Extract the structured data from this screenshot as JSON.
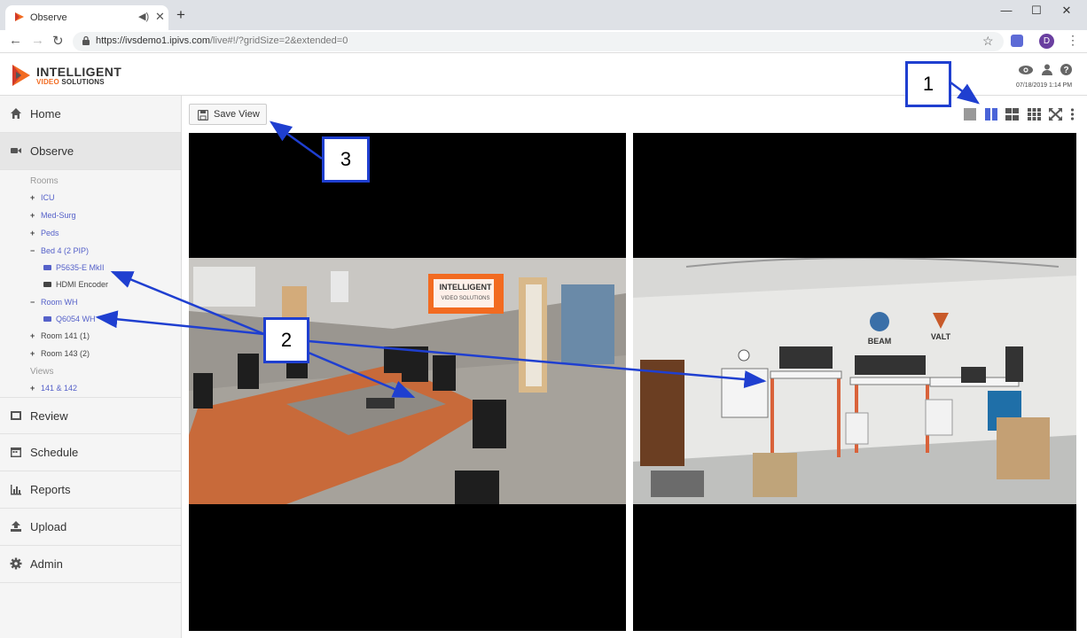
{
  "browser": {
    "tab_title": "Observe",
    "url_host": "https://ivsdemo1.ipivs.com",
    "url_path": "/live#!/?gridSize=2&extended=0",
    "profile_initial": "D"
  },
  "header": {
    "logo_line1": "INTELLIGENT",
    "logo_line2a": "VIDEO",
    "logo_line2b": "SOLUTIONS",
    "datetime": "07/18/2019 1:14 PM"
  },
  "sidebar": {
    "nav": [
      {
        "label": "Home",
        "icon": "home-icon"
      },
      {
        "label": "Observe",
        "icon": "video-camera-icon"
      },
      {
        "label": "Review",
        "icon": "film-icon"
      },
      {
        "label": "Schedule",
        "icon": "calendar-icon"
      },
      {
        "label": "Reports",
        "icon": "bar-chart-icon"
      },
      {
        "label": "Upload",
        "icon": "upload-icon"
      },
      {
        "label": "Admin",
        "icon": "gear-icon"
      }
    ],
    "rooms_header": "Rooms",
    "views_header": "Views",
    "tree": [
      {
        "sign": "+",
        "label": "ICU"
      },
      {
        "sign": "+",
        "label": "Med-Surg"
      },
      {
        "sign": "+",
        "label": "Peds"
      },
      {
        "sign": "−",
        "label": "Bed 4 (2 PIP)"
      },
      {
        "camera": true,
        "label": "P5635-E MkII"
      },
      {
        "camera": true,
        "label": "HDMI Encoder"
      },
      {
        "sign": "−",
        "label": "Room WH"
      },
      {
        "camera": true,
        "label": "Q6054 WH"
      },
      {
        "sign": "+",
        "label": "Room 141 (1)"
      },
      {
        "sign": "+",
        "label": "Room 143 (2)"
      }
    ],
    "views": [
      {
        "sign": "+",
        "label": "141 & 142"
      }
    ]
  },
  "toolbar": {
    "save_view": "Save View"
  },
  "scene_left": {
    "sign_line1": "INTELLIGENT",
    "sign_line2": "VIDEO SOLUTIONS"
  },
  "scene_right": {
    "sign_beam": "BEAM",
    "sign_valt": "VALT"
  },
  "callouts": {
    "c1": "1",
    "c2": "2",
    "c3": "3"
  },
  "colors": {
    "accent": "#5561c9",
    "grid_active": "#4a64d8",
    "callout_border": "#1f3fd0",
    "brand_orange": "#f26b21"
  }
}
